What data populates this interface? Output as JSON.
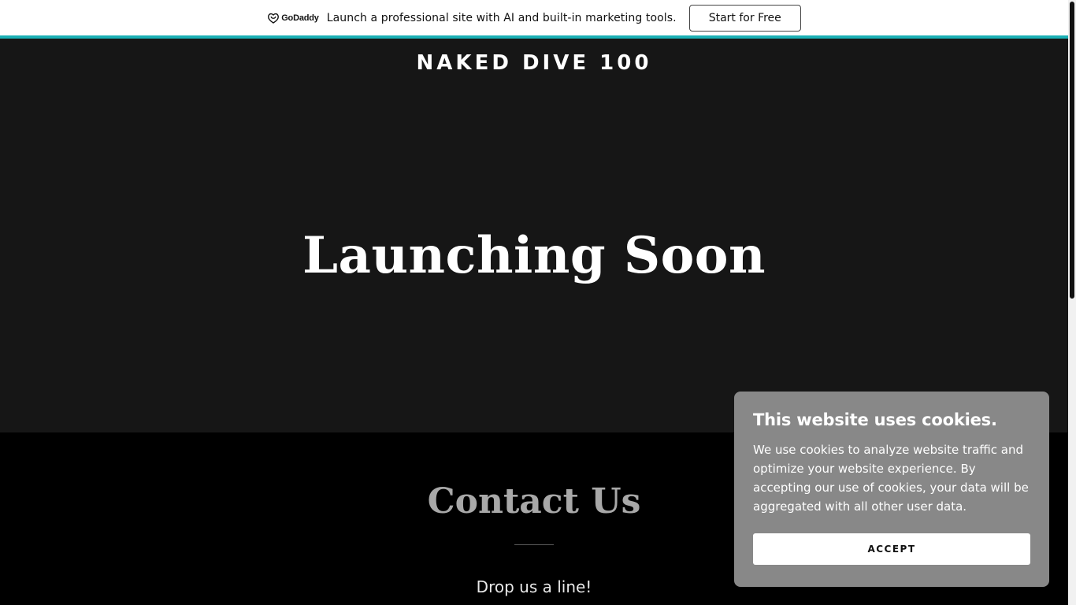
{
  "promo": {
    "brand_name": "GoDaddy",
    "brand_icon": "godaddy-logo-icon",
    "text": "Launch a professional site with AI and built-in marketing tools.",
    "button_label": "Start for Free",
    "accent_color": "#1bb0b5"
  },
  "header": {
    "site_title": "NAKED DIVE 100"
  },
  "hero": {
    "heading": "Launching Soon",
    "background_color": "#161616"
  },
  "contact": {
    "heading": "Contact Us",
    "subheading": "Drop us a line!"
  },
  "cookie_banner": {
    "title": "This website uses cookies.",
    "body": "We use cookies to analyze website traffic and optimize your website experience. By accepting our use of cookies, your data will be aggregated with all other user data.",
    "accept_label": "ACCEPT",
    "background_color": "#888888"
  }
}
